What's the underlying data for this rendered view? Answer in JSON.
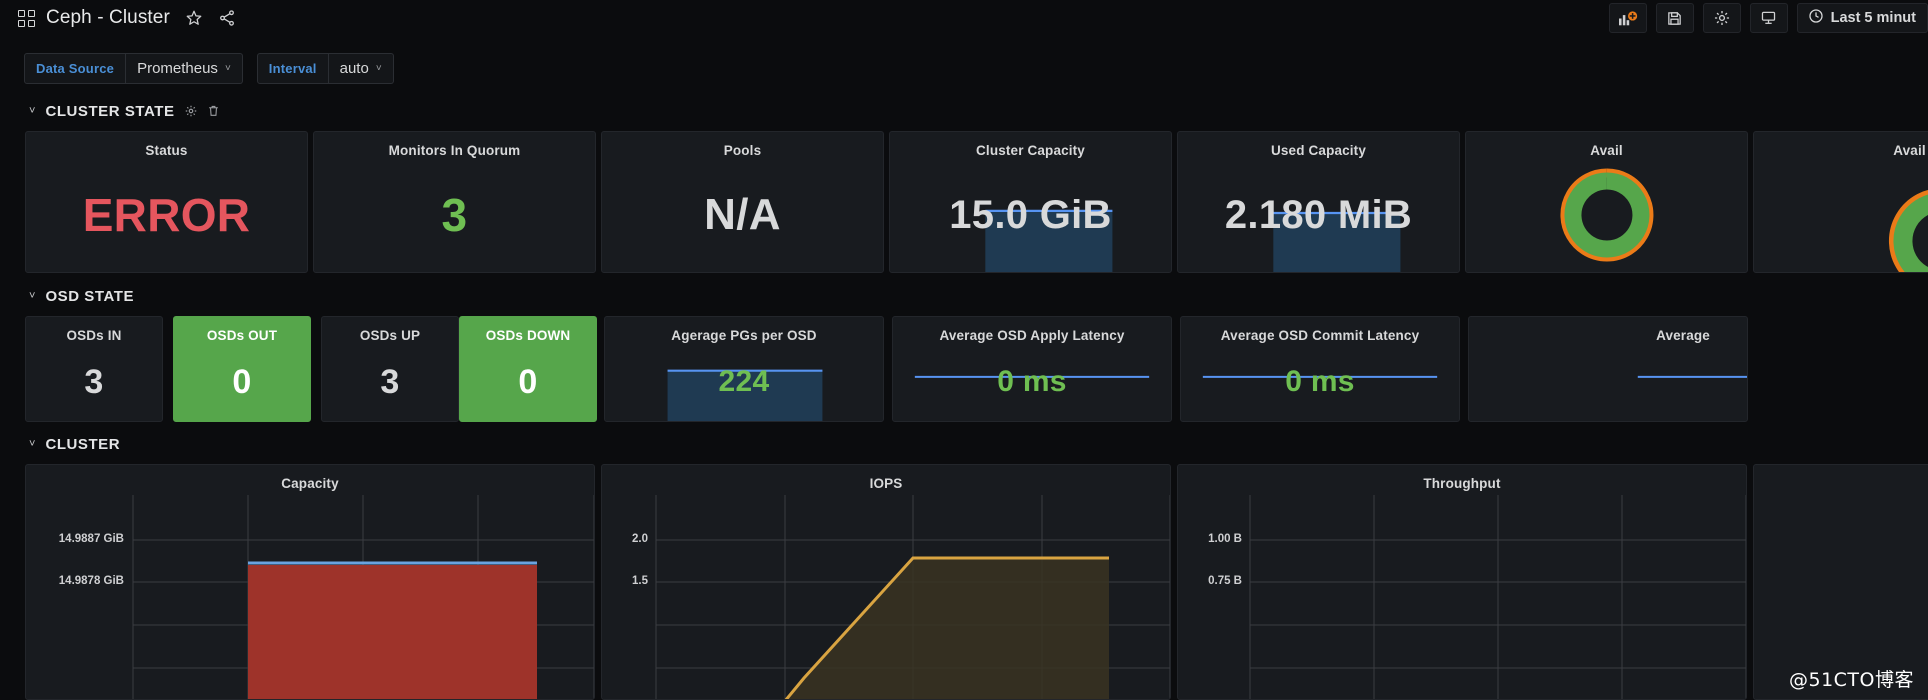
{
  "header": {
    "grid_icon": "grid-icon",
    "title": "Ceph - Cluster",
    "star_icon": "star-icon",
    "share_icon": "share-icon",
    "add_panel_icon": "add-panel-icon",
    "save_icon": "save-icon",
    "settings_icon": "gear-icon",
    "kiosk_icon": "tv-kiosk-icon",
    "clock_icon": "clock-icon",
    "time_range": "Last 5 minut"
  },
  "variables": [
    {
      "label": "Data Source",
      "value": "Prometheus",
      "caret": "˅"
    },
    {
      "label": "Interval",
      "value": "auto",
      "caret": "˅"
    }
  ],
  "rows": [
    {
      "title": "CLUSTER STATE",
      "chevron": "˅",
      "gear_icon": "gear-icon",
      "trash_icon": "trash-icon",
      "has_icons": true
    },
    {
      "title": "OSD STATE",
      "chevron": "˅",
      "has_icons": false
    },
    {
      "title": "CLUSTER",
      "chevron": "˅",
      "has_icons": false
    }
  ],
  "cluster_state_panels": [
    {
      "title": "Status",
      "value": "ERROR",
      "color": "#e5565e",
      "font_size": 46,
      "style": "plain"
    },
    {
      "title": "Monitors In Quorum",
      "value": "3",
      "color": "#6fbf52",
      "font_size": 46,
      "style": "plain"
    },
    {
      "title": "Pools",
      "value": "N/A",
      "color": "#d8d9da",
      "font_size": 44,
      "style": "plain"
    },
    {
      "title": "Cluster Capacity",
      "value": "15.0 GiB",
      "color": "#d8d9da",
      "font_size": 40,
      "style": "sparkline-fill"
    },
    {
      "title": "Used Capacity",
      "value": "2.180 MiB",
      "color": "#d8d9da",
      "font_size": 40,
      "style": "sparkline-fill"
    },
    {
      "title": "Avail",
      "value": "",
      "color": "#d8d9da",
      "font_size": 40,
      "style": "gauge"
    }
  ],
  "osd_state_panels": [
    {
      "title": "OSDs IN",
      "value": "3",
      "color": "#d8d9da",
      "font_size": 34,
      "bg": "dark",
      "style": "plain"
    },
    {
      "title": "OSDs OUT",
      "value": "0",
      "color": "#ffffff",
      "font_size": 34,
      "bg": "green",
      "style": "plain"
    },
    {
      "title": "OSDs UP",
      "value": "3",
      "color": "#d8d9da",
      "font_size": 34,
      "bg": "dark",
      "style": "plain"
    },
    {
      "title": "OSDs DOWN",
      "value": "0",
      "color": "#ffffff",
      "font_size": 34,
      "bg": "green",
      "style": "plain"
    },
    {
      "title": "Agerage PGs per OSD",
      "value": "224",
      "color": "#6fbf52",
      "font_size": 30,
      "bg": "dark",
      "style": "sparkline-fill"
    },
    {
      "title": "Average OSD Apply Latency",
      "value": "0 ms",
      "color": "#6fbf52",
      "font_size": 30,
      "bg": "dark",
      "style": "sparkline-line"
    },
    {
      "title": "Average OSD Commit Latency",
      "value": "0 ms",
      "color": "#6fbf52",
      "font_size": 30,
      "bg": "dark",
      "style": "sparkline-line"
    },
    {
      "title": "Average",
      "value": "",
      "color": "#6fbf52",
      "font_size": 30,
      "bg": "dark",
      "style": "sparkline-line"
    }
  ],
  "cluster_graphs": [
    {
      "title": "Capacity",
      "yticks": [
        "14.9887 GiB",
        "14.9878 GiB"
      ]
    },
    {
      "title": "IOPS",
      "yticks": [
        "2.0",
        "1.5"
      ]
    },
    {
      "title": "Throughput",
      "yticks": [
        "1.00 B",
        "0.75 B"
      ]
    }
  ],
  "chart_data": [
    {
      "type": "area",
      "title": "Capacity",
      "ylabel": "",
      "xlabel": "",
      "yticks": [
        14.9887,
        14.9878
      ],
      "ytick_labels": [
        "14.9887 GiB",
        "14.9878 GiB"
      ],
      "grid": true,
      "series": [
        {
          "name": "capacity-line",
          "color": "#5794f2",
          "values": [
            null,
            null,
            14.98845,
            14.98845,
            14.98845,
            14.98845
          ]
        },
        {
          "name": "capacity-area",
          "color": "#a8342a",
          "values": [
            null,
            null,
            14.98845,
            14.98845,
            14.98845,
            14.98845
          ]
        }
      ],
      "x": [
        0,
        1,
        2,
        3,
        4,
        5
      ]
    },
    {
      "type": "line",
      "title": "IOPS",
      "ylabel": "",
      "xlabel": "",
      "yticks": [
        2.0,
        1.5
      ],
      "ytick_labels": [
        "2.0",
        "1.5"
      ],
      "ylim": [
        1.0,
        2.1
      ],
      "grid": true,
      "series": [
        {
          "name": "iops",
          "color": "#d9a441",
          "values": [
            null,
            null,
            1.15,
            1.85,
            1.85,
            1.85
          ]
        }
      ],
      "x": [
        0,
        1,
        2,
        3,
        4,
        5
      ]
    },
    {
      "type": "line",
      "title": "Throughput",
      "ylabel": "",
      "xlabel": "",
      "yticks": [
        1.0,
        0.75
      ],
      "ytick_labels": [
        "1.00 B",
        "0.75 B"
      ],
      "grid": true,
      "series": [],
      "x": [
        0,
        1,
        2,
        3,
        4,
        5
      ]
    }
  ],
  "watermark": "@51CTO博客"
}
